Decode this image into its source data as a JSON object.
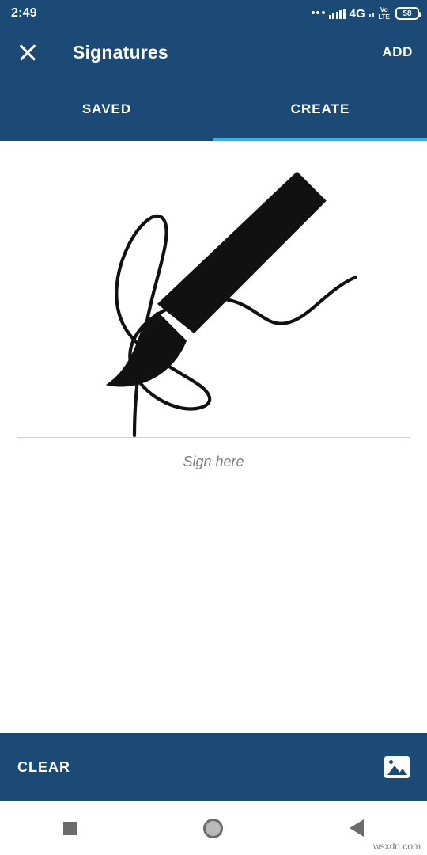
{
  "status_bar": {
    "time": "2:49",
    "network": "4G",
    "volte_top": "Vo",
    "volte_bottom": "LTE",
    "battery": "58"
  },
  "app_bar": {
    "close_icon": "close-icon",
    "title": "Signatures",
    "add_label": "ADD"
  },
  "tabs": [
    {
      "label": "SAVED",
      "active": false
    },
    {
      "label": "CREATE",
      "active": true
    }
  ],
  "canvas": {
    "hint": "Sign here",
    "brush_icon": "brush-icon"
  },
  "action_bar": {
    "clear_label": "CLEAR",
    "image_icon": "image-picker-icon"
  },
  "nav_bar": {
    "recents": "square-recents-icon",
    "home": "circle-home-icon",
    "back": "triangle-back-icon"
  },
  "watermark": "wsxdn.com",
  "colors": {
    "app_bar": "#1b4a77",
    "accent": "#29b6f6",
    "ink": "#111111",
    "hint": "#7d7d7d"
  }
}
